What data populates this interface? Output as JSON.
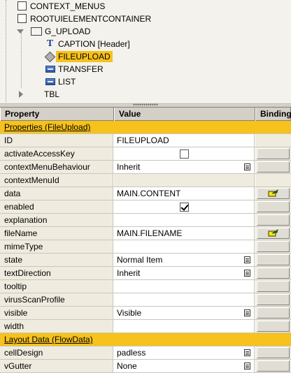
{
  "tree": {
    "items": [
      {
        "label": "CONTEXT_MENUS"
      },
      {
        "label": "ROOTUIELEMENTCONTAINER"
      },
      {
        "label": "G_UPLOAD"
      },
      {
        "label": "CAPTION  [Header]"
      },
      {
        "label": "FILEUPLOAD"
      },
      {
        "label": "TRANSFER"
      },
      {
        "label": "LIST"
      },
      {
        "label": "TBL"
      }
    ]
  },
  "grid": {
    "headers": {
      "property": "Property",
      "value": "Value",
      "binding": "Binding"
    },
    "section1": "Properties (FileUpload)",
    "rows": [
      {
        "property": "ID",
        "value": "FILEUPLOAD"
      },
      {
        "property": "activateAccessKey",
        "value": ""
      },
      {
        "property": "contextMenuBehaviour",
        "value": "Inherit"
      },
      {
        "property": "contextMenuId",
        "value": ""
      },
      {
        "property": "data",
        "value": "MAIN.CONTENT"
      },
      {
        "property": "enabled",
        "value": ""
      },
      {
        "property": "explanation",
        "value": ""
      },
      {
        "property": "fileName",
        "value": "MAIN.FILENAME"
      },
      {
        "property": "mimeType",
        "value": ""
      },
      {
        "property": "state",
        "value": "Normal Item"
      },
      {
        "property": "textDirection",
        "value": "Inherit"
      },
      {
        "property": "tooltip",
        "value": ""
      },
      {
        "property": "virusScanProfile",
        "value": ""
      },
      {
        "property": "visible",
        "value": "Visible"
      },
      {
        "property": "width",
        "value": ""
      }
    ],
    "section2": "Layout Data (FlowData)",
    "rows2": [
      {
        "property": "cellDesign",
        "value": "padless"
      },
      {
        "property": "vGutter",
        "value": "None"
      }
    ]
  },
  "checkboxes": {
    "activateAccessKey": false,
    "enabled": true
  },
  "colors": {
    "selection": "#f6c21b",
    "tree_bg": "#f3f2ec",
    "cell_bg": "#efebde"
  }
}
